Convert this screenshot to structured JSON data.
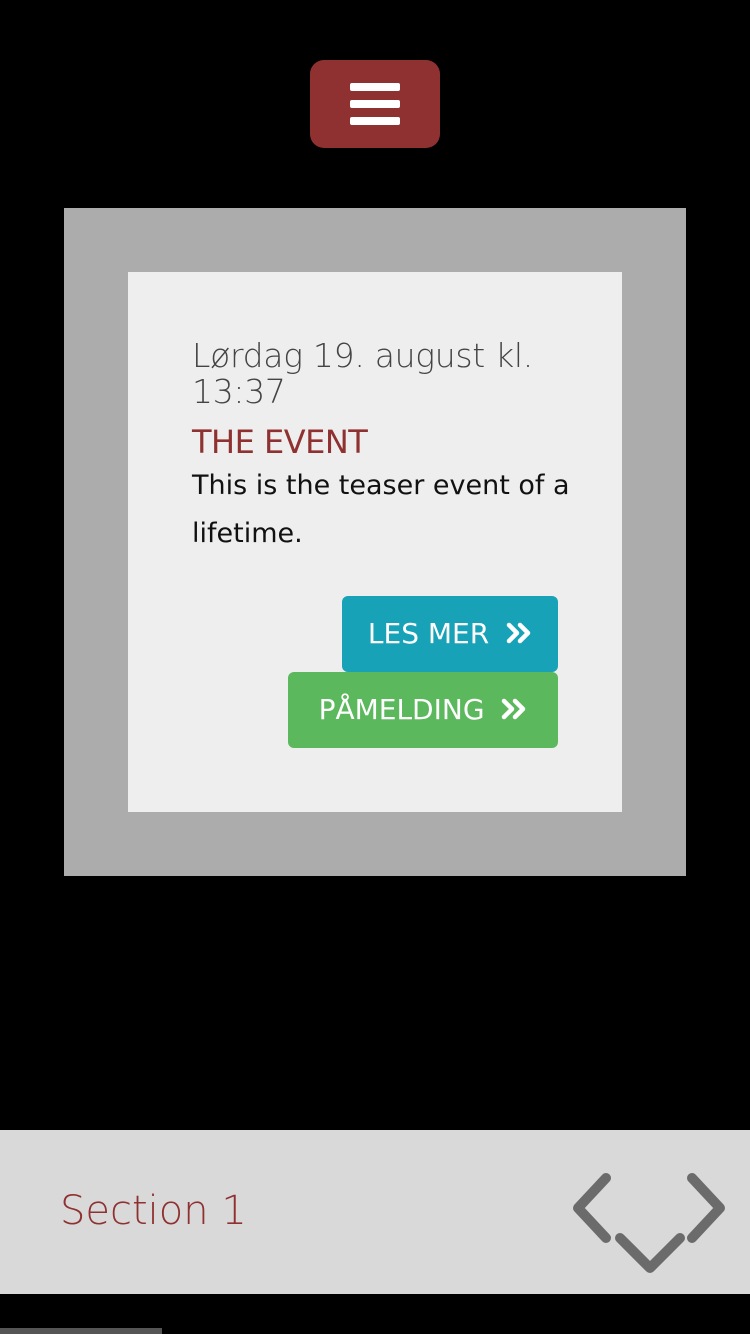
{
  "header": {
    "menu_icon": "hamburger-menu-icon"
  },
  "event_card": {
    "date": "Lørdag 19. august kl. 13:37",
    "title": "THE EVENT",
    "description": "This is the teaser event of a lifetime.",
    "read_more_label": "LES MER",
    "signup_label": "PÅMELDING",
    "button_icon": "double-chevron-right-icon"
  },
  "footer": {
    "section_label": "Section 1",
    "nav_icons": [
      "chevron-left-icon",
      "chevron-down-icon",
      "chevron-right-icon"
    ]
  },
  "colors": {
    "brand_red": "#8f3131",
    "info_teal": "#17a2b8",
    "success_green": "#5cb85c",
    "frame_gray": "#acacac",
    "card_bg": "#eeeeee",
    "footer_bg": "#d9d9d9",
    "nav_icon_gray": "#6b6b6b"
  }
}
